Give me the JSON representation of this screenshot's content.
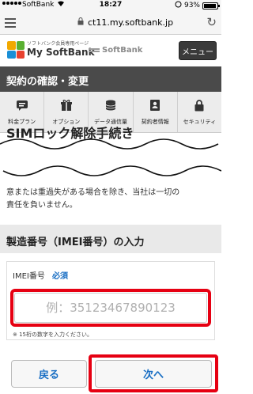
{
  "status_bar": {
    "carrier": "SoftBank",
    "time": "18:27",
    "battery": "93%",
    "battery_level": 0.93
  },
  "browser": {
    "url": "ct11.my.softbank.jp"
  },
  "header": {
    "logo_subtitle": "ソフトバンク会員専用ページ",
    "logo_title": "My SoftBank",
    "brand_name": "SoftBank",
    "menu_label": "メニュー"
  },
  "section": {
    "title": "契約の確認・変更"
  },
  "nav": {
    "items": [
      {
        "label": "料金プラン",
        "icon": "plan-icon"
      },
      {
        "label": "オプション",
        "icon": "option-icon"
      },
      {
        "label": "データ通信量",
        "icon": "data-icon"
      },
      {
        "label": "契約者情報",
        "icon": "contract-icon"
      },
      {
        "label": "セキュリティ",
        "icon": "lock-icon"
      }
    ]
  },
  "page": {
    "heading": "SIMロック解除手続き",
    "body_line1": "意または重過失がある場合を除き、当社は一切の",
    "body_line2": "責任を負いません。"
  },
  "imei_section": {
    "title": "製造番号（IMEI番号）の入力",
    "field_label": "IMEI番号",
    "required_label": "必須",
    "placeholder": "例：35123467890123",
    "note": "※ 15桁の数字を入力ください。"
  },
  "buttons": {
    "back_label": "戻る",
    "next_label": "次へ"
  },
  "colors": {
    "highlight": "#e60012",
    "link": "#1a6fc4",
    "section_bg": "#4a4a4a"
  }
}
